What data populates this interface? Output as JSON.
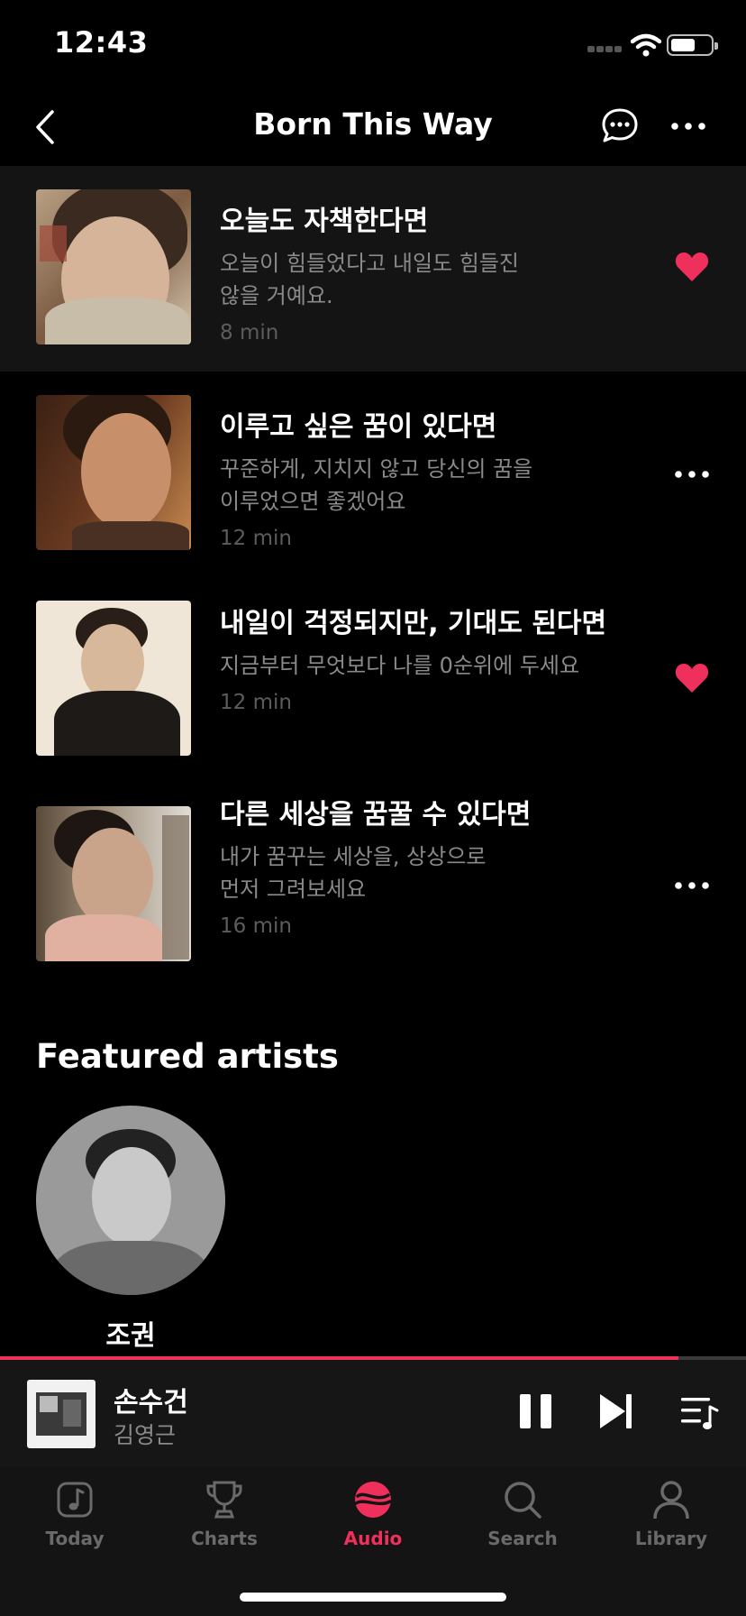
{
  "status_bar": {
    "time": "12:43"
  },
  "nav": {
    "title": "Born This Way"
  },
  "episodes": [
    {
      "title": "오늘도 자책한다면",
      "desc_line1": "오늘이 힘들었다고 내일도 힘들진",
      "desc_line2": "않을 거예요.",
      "duration": "8 min",
      "liked": true
    },
    {
      "title": "이루고 싶은 꿈이 있다면",
      "desc_line1": "꾸준하게, 지치지 않고 당신의 꿈을",
      "desc_line2": "이루었으면 좋겠어요",
      "duration": "12 min",
      "liked": false
    },
    {
      "title": "내일이 걱정되지만, 기대도 된다면",
      "desc_line1": "지금부터 무엇보다 나를 0순위에 두세요",
      "desc_line2": "",
      "duration": "12 min",
      "liked": true
    },
    {
      "title": "다른 세상을 꿈꿀 수 있다면",
      "desc_line1": "내가 꿈꾸는 세상을, 상상으로",
      "desc_line2": "먼저 그려보세요",
      "duration": "16 min",
      "liked": false
    }
  ],
  "featured": {
    "title": "Featured artists",
    "artists": [
      {
        "name": "조권"
      }
    ]
  },
  "now_playing": {
    "title": "손수건",
    "artist": "김영근",
    "progress": 0.91
  },
  "tabs": [
    {
      "label": "Today",
      "icon": "music-note-icon",
      "active": false
    },
    {
      "label": "Charts",
      "icon": "trophy-icon",
      "active": false
    },
    {
      "label": "Audio",
      "icon": "audio-icon",
      "active": true
    },
    {
      "label": "Search",
      "icon": "search-icon",
      "active": false
    },
    {
      "label": "Library",
      "icon": "person-icon",
      "active": false
    }
  ],
  "colors": {
    "accent": "#f0305c",
    "background": "#000000",
    "active_row": "#141414"
  }
}
